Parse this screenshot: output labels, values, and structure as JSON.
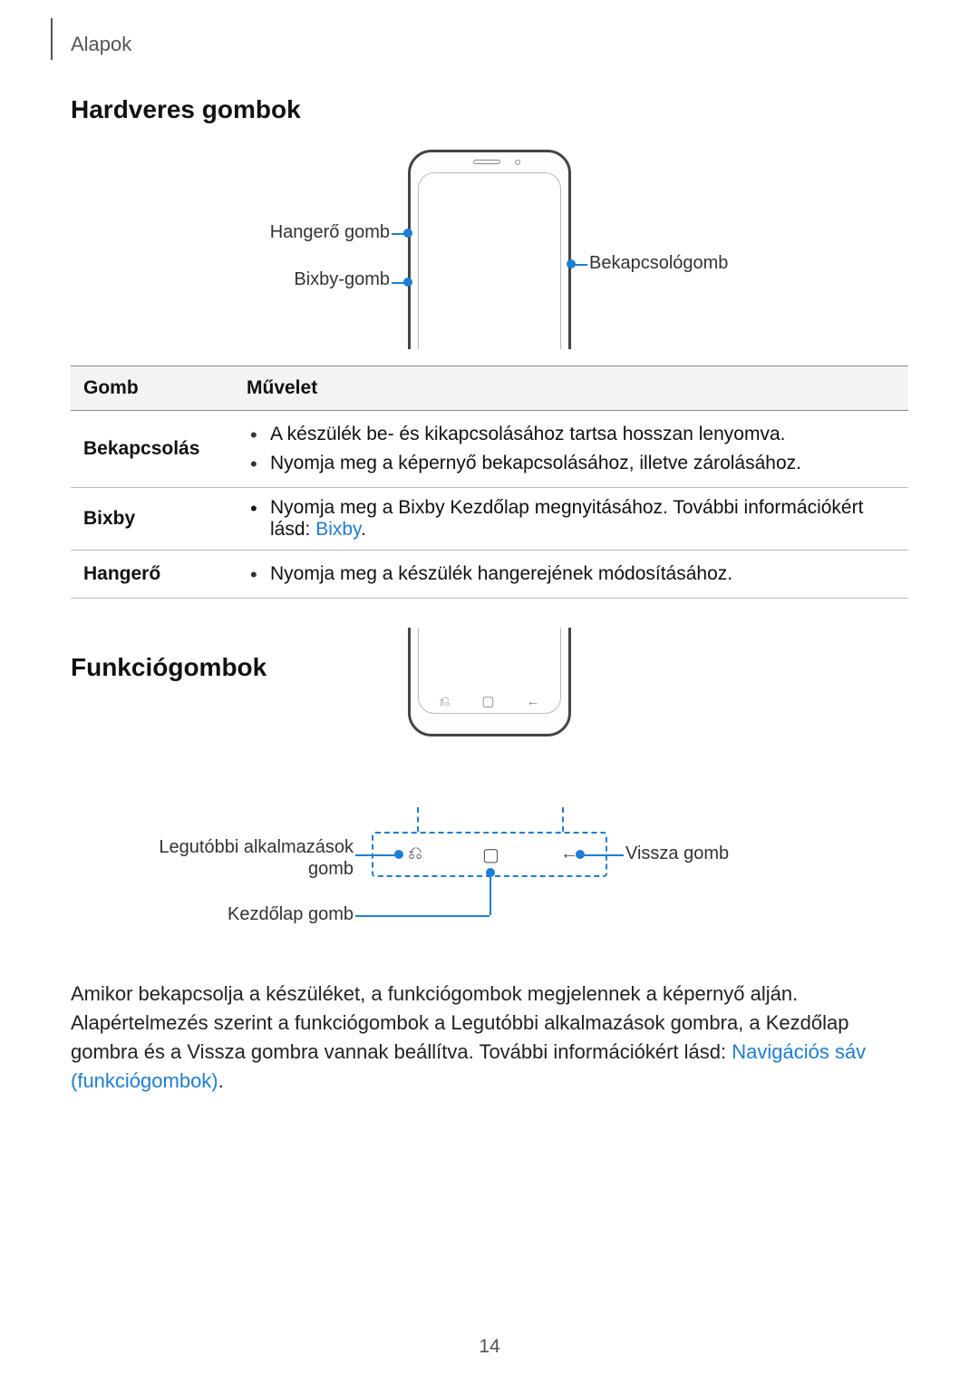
{
  "header": {
    "section": "Alapok"
  },
  "h1": "Hardveres gombok",
  "diagram1": {
    "labels": {
      "volume": "Hangerő gomb",
      "bixby": "Bixby-gomb",
      "power": "Bekapcsológomb"
    }
  },
  "table": {
    "head": {
      "key": "Gomb",
      "action": "Művelet"
    },
    "rows": [
      {
        "key": "Bekapcsolás",
        "actions": [
          "A készülék be- és kikapcsolásához tartsa hosszan lenyomva.",
          "Nyomja meg a képernyő bekapcsolásához, illetve zárolásához."
        ]
      },
      {
        "key": "Bixby",
        "action_prefix": "Nyomja meg a Bixby Kezdőlap megnyitásához. További információkért lásd: ",
        "action_link": "Bixby",
        "action_suffix": "."
      },
      {
        "key": "Hangerő",
        "actions": [
          "Nyomja meg a készülék hangerejének módosításához."
        ]
      }
    ]
  },
  "h2": "Funkciógombok",
  "diagram2": {
    "labels": {
      "recents": "Legutóbbi alkalmazások gomb",
      "home": "Kezdőlap gomb",
      "back": "Vissza gomb"
    },
    "icons": {
      "recents": "⎌",
      "home": "▢",
      "back": "←"
    }
  },
  "paragraph": {
    "text_before": "Amikor bekapcsolja a készüléket, a funkciógombok megjelennek a képernyő alján. Alapértelmezés szerint a funkciógombok a Legutóbbi alkalmazások gombra, a Kezdőlap gombra és a Vissza gombra vannak beállítva. További információkért lásd: ",
    "link": "Navigációs sáv (funkciógombok)",
    "text_after": "."
  },
  "page_number": "14",
  "chart_data": {
    "type": "table",
    "columns": [
      "Gomb",
      "Művelet"
    ],
    "rows": [
      [
        "Bekapcsolás",
        "A készülék be- és kikapcsolásához tartsa hosszan lenyomva."
      ],
      [
        "Bekapcsolás",
        "Nyomja meg a képernyő bekapcsolásához, illetve zárolásához."
      ],
      [
        "Bixby",
        "Nyomja meg a Bixby Kezdőlap megnyitásához. További információkért lásd: Bixby."
      ],
      [
        "Hangerő",
        "Nyomja meg a készülék hangerejének módosításához."
      ]
    ]
  }
}
